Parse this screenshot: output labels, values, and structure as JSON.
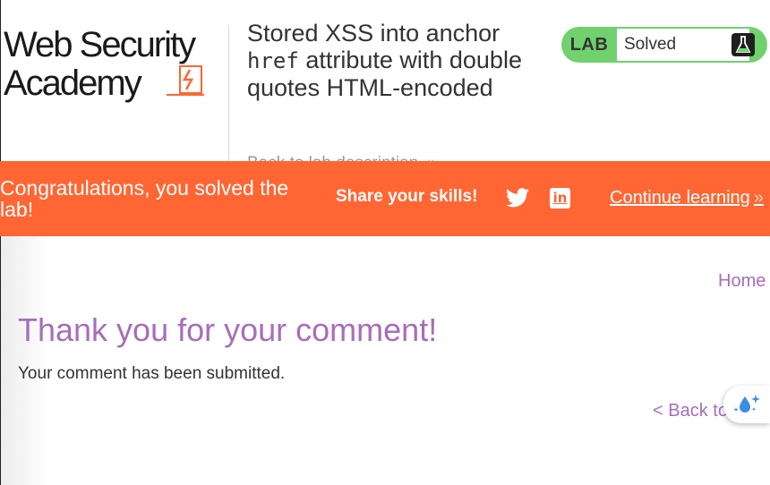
{
  "header": {
    "logo": {
      "line1": "Web Security",
      "line2": "Academy"
    },
    "title_prefix": "Stored XSS into anchor",
    "title_code": "href",
    "title_suffix": "attribute with double quotes HTML-encoded",
    "back_link": "Back to lab description",
    "back_link_icon": "double-chevron-right-icon",
    "lab_status": {
      "tag": "LAB",
      "status": "Solved",
      "icon": "flask-icon",
      "color": "#70d16d"
    }
  },
  "banner": {
    "congrats": "Congratulations, you solved the lab!",
    "share_label": "Share your skills!",
    "social": [
      "twitter-icon",
      "linkedin-icon"
    ],
    "linkedin_glyph": "in",
    "continue_label": "Continue learning",
    "color": "#ff6633"
  },
  "main": {
    "home_link": "Home",
    "heading": "Thank you for your comment!",
    "message": "Your comment has been submitted.",
    "back_link": "< Back to",
    "accent": "#a86dbb"
  },
  "floating_button": {
    "icon": "water-drop-sparkle-icon"
  }
}
